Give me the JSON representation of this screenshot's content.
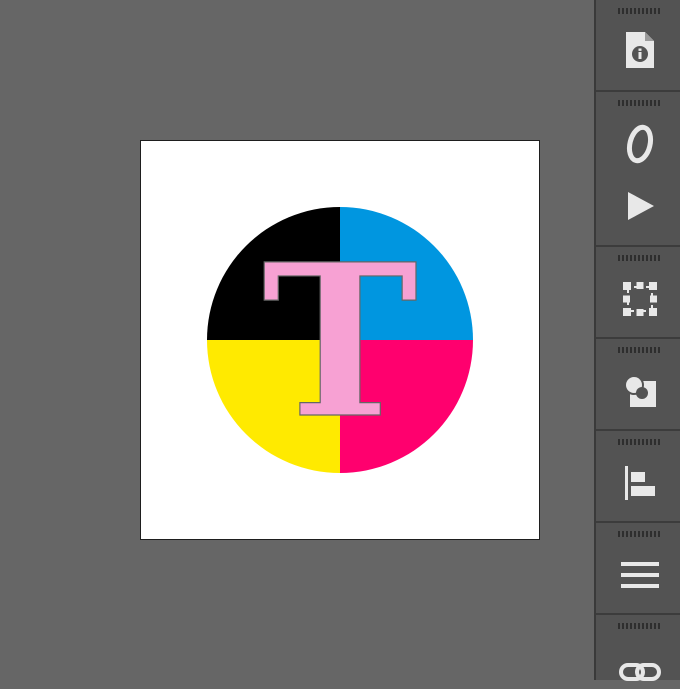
{
  "artwork": {
    "letter": "T",
    "colors": {
      "top_left": "#000000",
      "top_right": "#0096e0",
      "bottom_left": "#ffea00",
      "bottom_right": "#ff006e",
      "letter_fill": "#f7a1d3",
      "letter_stroke": "#666666"
    }
  },
  "panels": [
    {
      "id": "document-info",
      "icon": "document-info-icon"
    },
    {
      "id": "glyphs",
      "icon": "italic-o-icon"
    },
    {
      "id": "actions",
      "icon": "play-icon"
    },
    {
      "id": "transform",
      "icon": "transform-bounding-box-icon"
    },
    {
      "id": "pathfinder",
      "icon": "pathfinder-icon"
    },
    {
      "id": "align",
      "icon": "align-left-icon"
    },
    {
      "id": "paragraph",
      "icon": "paragraph-lines-icon"
    },
    {
      "id": "links",
      "icon": "link-icon"
    }
  ],
  "theme": {
    "workspace": "#666666",
    "panel": "#535353",
    "icon": "#e8e8e8"
  }
}
